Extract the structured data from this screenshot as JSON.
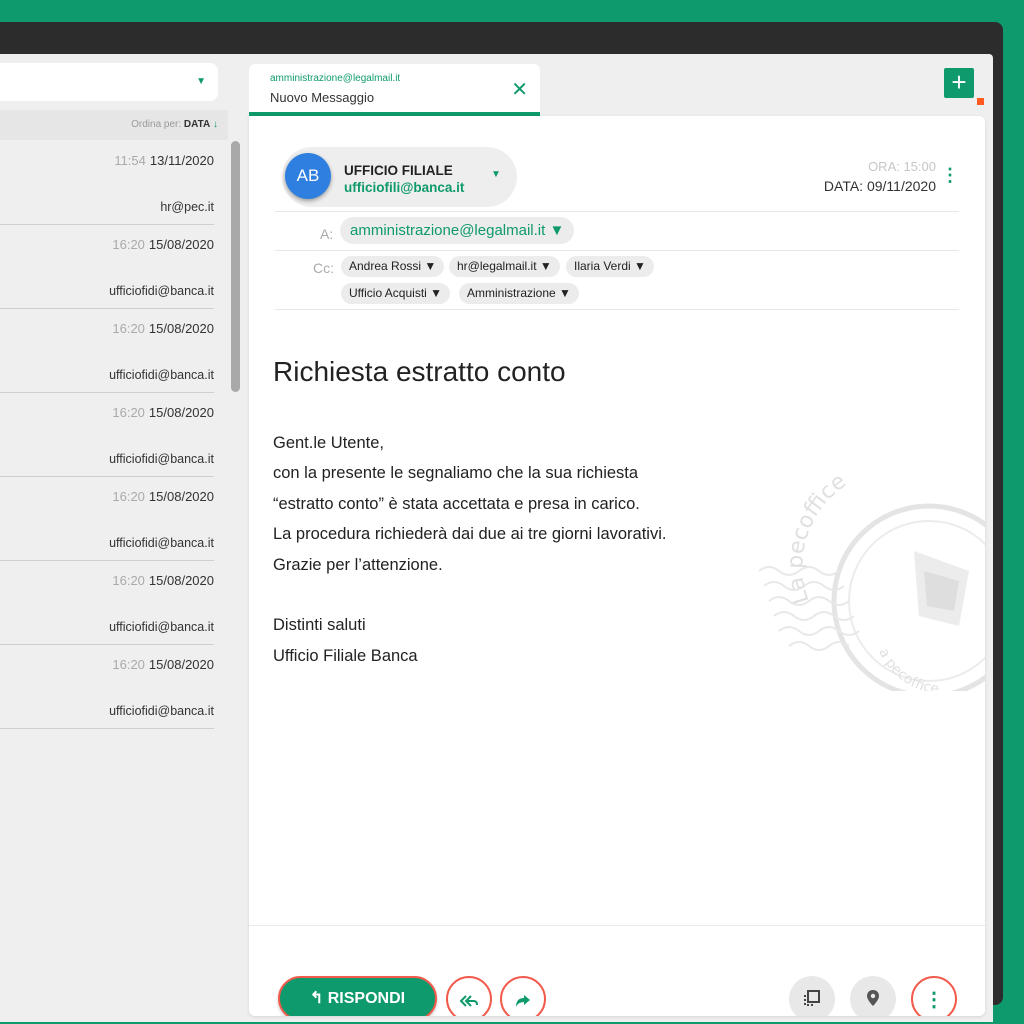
{
  "sidebar": {
    "order_label": "Ordina per:",
    "order_value": "DATA",
    "order_arrow": "↓",
    "items": [
      {
        "time": "11:54",
        "date": "13/11/2020",
        "from": "hr@pec.it"
      },
      {
        "time": "16:20",
        "date": "15/08/2020",
        "from": "ufficiofidi@banca.it"
      },
      {
        "time": "16:20",
        "date": "15/08/2020",
        "from": "ufficiofidi@banca.it"
      },
      {
        "time": "16:20",
        "date": "15/08/2020",
        "from": "ufficiofidi@banca.it"
      },
      {
        "time": "16:20",
        "date": "15/08/2020",
        "from": "ufficiofidi@banca.it"
      },
      {
        "time": "16:20",
        "date": "15/08/2020",
        "from": "ufficiofidi@banca.it"
      },
      {
        "time": "16:20",
        "date": "15/08/2020",
        "from": "ufficiofidi@banca.it"
      }
    ]
  },
  "tab": {
    "address": "amministrazione@legalmail.it",
    "title": "Nuovo Messaggio",
    "close": "✕"
  },
  "new_button": "+",
  "message": {
    "avatar": "AB",
    "sender_name": "UFFICIO FILIALE",
    "sender_email": "ufficiofili@banca.it",
    "time": "ORA: 15:00",
    "date": "DATA: 09/11/2020",
    "to_label": "A:",
    "to": "amministrazione@legalmail.it ▼",
    "cc_label": "Cc:",
    "cc": [
      "Andrea Rossi ▼",
      "hr@legalmail.it ▼",
      "Ilaria Verdi ▼",
      "Ufficio Acquisti ▼",
      "Amministrazione ▼"
    ],
    "subject": "Richiesta estratto conto",
    "body": [
      "Gent.le Utente,",
      "con la presente le segnaliamo che la sua richiesta",
      "“estratto conto” è stata accettata e presa in carico.",
      "La procedura richiederà dai due ai tre giorni lavorativi.",
      "Grazie per l’attenzione.",
      "",
      "Distinti saluti",
      "Ufficio Filiale Banca"
    ],
    "stamp_text_top": "La pecoffice",
    "stamp_text_bottom": "a pecoffice"
  },
  "actions": {
    "reply": "↰ RISPONDI",
    "reply_all_icon": "reply-all-icon",
    "forward_icon": "forward-icon",
    "copy_icon": "copy-icon",
    "location_icon": "location-icon",
    "more_icon": "more-icon"
  },
  "colors": {
    "brand_green": "#0e9a6c",
    "accent_red": "#f25a4c",
    "avatar_blue": "#2f7fe0"
  }
}
